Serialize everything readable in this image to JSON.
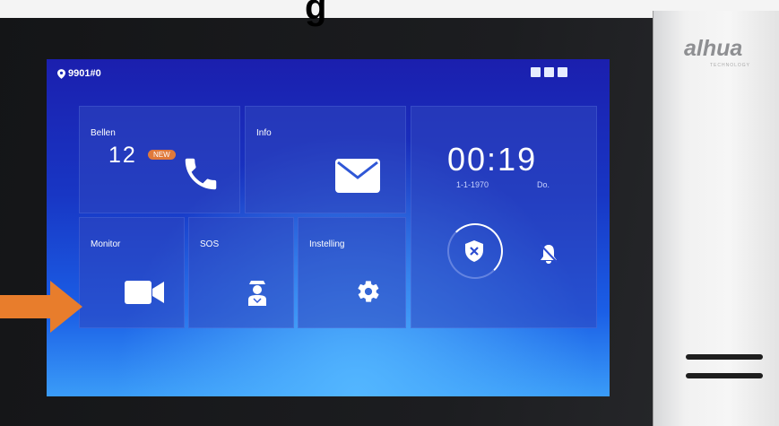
{
  "header": {
    "partial_text": "g"
  },
  "status_bar": {
    "location": "9901#0",
    "icons": [
      "sd-card-icon",
      "image-icon",
      "message-icon"
    ]
  },
  "tiles": {
    "bellen": {
      "label": "Bellen",
      "count": "12",
      "badge": "NEW",
      "icon": "phone-icon"
    },
    "info": {
      "label": "Info",
      "icon": "envelope-icon"
    },
    "monitor": {
      "label": "Monitor",
      "icon": "video-camera-icon"
    },
    "sos": {
      "label": "SOS",
      "icon": "guard-icon"
    },
    "instelling": {
      "label": "Instelling",
      "icon": "gear-icon"
    }
  },
  "clock": {
    "time": "00:19",
    "date": "1-1-1970",
    "day": "Do."
  },
  "controls": {
    "arm_icon": "shield-x-icon",
    "alarm_icon": "bell-icon"
  },
  "brand": {
    "name": "alhua",
    "tagline": "TECHNOLOGY"
  },
  "colors": {
    "screen_blue": "#1b3fd0",
    "badge_orange": "#e0793b",
    "arrow_orange": "#e87d2c"
  }
}
